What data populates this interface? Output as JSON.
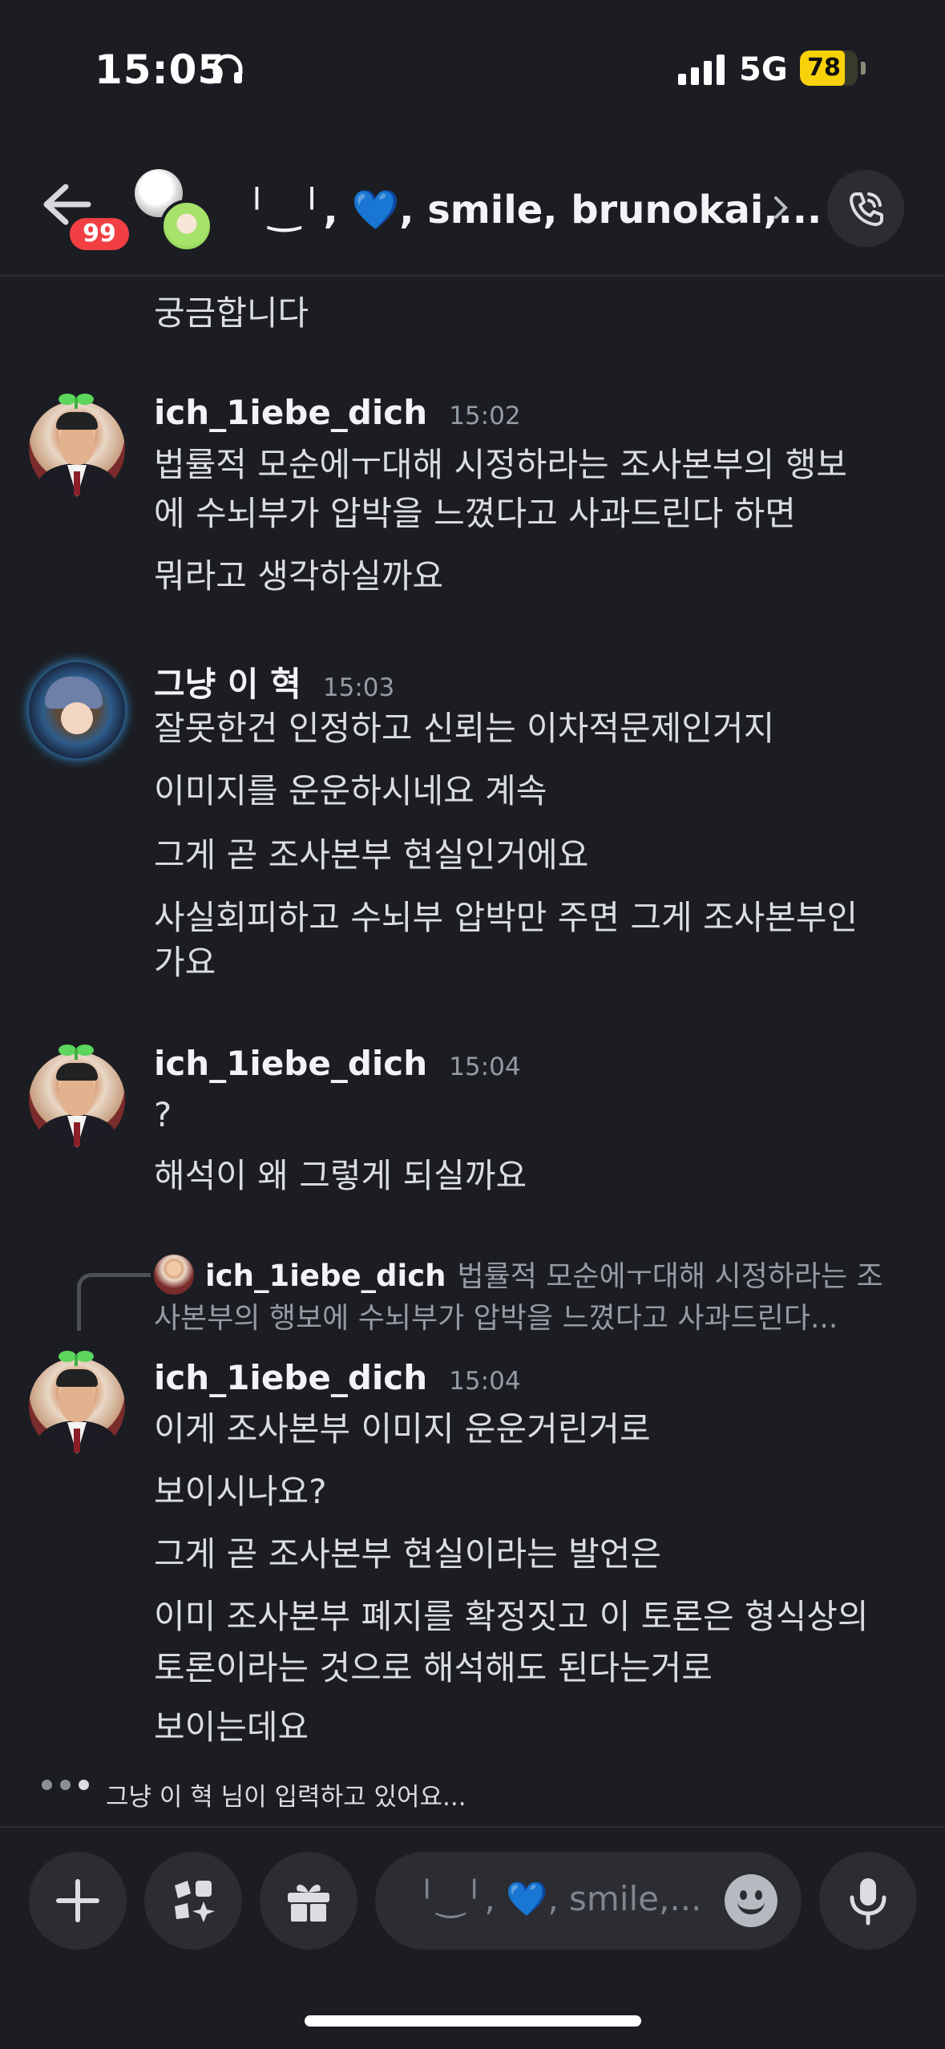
{
  "status_bar": {
    "time": "15:05",
    "network": "5G",
    "battery": "78",
    "battery_level": 0.78
  },
  "header": {
    "unread_count": "99",
    "title": "╵‿╵, 💙, smile, brunokai,...",
    "icons": [
      "back-arrow-icon",
      "chevron-right-icon",
      "phone-call-icon"
    ]
  },
  "messages": {
    "partial_first": "궁금합니다",
    "groups": [
      {
        "username": "ich_1iebe_dich",
        "time": "15:02",
        "lines": [
          "법률적 모순에ㅜ대해 시정하라는 조사본부의 행보",
          "에 수뇌부가 압박을 느꼈다고 사과드린다 하면",
          "뭐라고 생각하실까요"
        ]
      },
      {
        "username": "그냥 이 혁",
        "time": "15:03",
        "lines": [
          "잘못한건 인정하고 신뢰는 이차적문제인거지",
          "이미지를 운운하시네요 계속",
          "그게 곧 조사본부 현실인거에요",
          "사실회피하고 수뇌부 압박만 주면 그게 조사본부인",
          "가요"
        ]
      },
      {
        "username": "ich_1iebe_dich",
        "time": "15:04",
        "lines": [
          "?",
          "해석이 왜 그렇게 되실까요"
        ]
      },
      {
        "reply": {
          "username": "ich_1iebe_dich",
          "text_line1": "법률적 모순에ㅜ대해 시정하라는 조",
          "text_line2": "사본부의 행보에 수뇌부가 압박을 느꼈다고 사과드린다..."
        },
        "username": "ich_1iebe_dich",
        "time": "15:04",
        "lines": [
          "이게 조사본부 이미지 운운거린거로",
          "보이시나요?",
          "그게 곧 조사본부 현실이라는 발언은",
          "이미 조사본부 폐지를 확정짓고 이 토론은 형식상의",
          "토론이라는 것으로 해석해도 된다는거로",
          "보이는데요"
        ]
      }
    ]
  },
  "typing": {
    "text": "그냥 이 혁 님이 입력하고 있어요..."
  },
  "composer": {
    "placeholder": "╵‿╵, 💙, smile,...",
    "icons": [
      "plus-icon",
      "apps-icon",
      "gift-icon",
      "emoji-icon",
      "microphone-icon"
    ]
  },
  "colors": {
    "background": "#1c1d22",
    "badge": "#f23f43",
    "battery": "#f7d20a"
  }
}
